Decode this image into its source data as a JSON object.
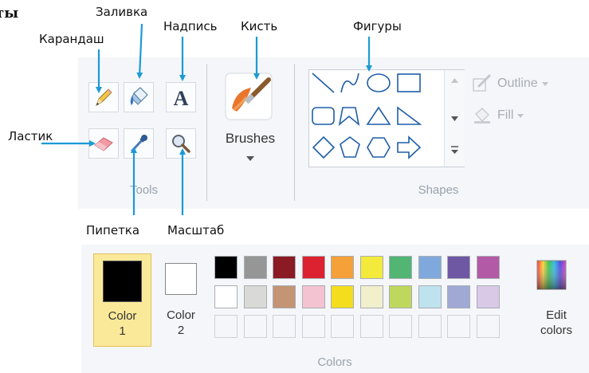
{
  "cutoff_heading": "ты",
  "callouts": {
    "fill": "Заливка",
    "pencil": "Карандаш",
    "text": "Надпись",
    "brush": "Кисть",
    "shapes": "Фигуры",
    "eraser": "Ластик",
    "picker": "Пипетка",
    "magnifier": "Масштаб"
  },
  "ribbon": {
    "tools_label": "Tools",
    "brushes_label": "Brushes",
    "shapes_label": "Shapes",
    "outline_label": "Outline",
    "fill_label": "Fill"
  },
  "colors": {
    "color1_line1": "Color",
    "color1_line2": "1",
    "color2_line1": "Color",
    "color2_line2": "2",
    "edit_line1": "Edit",
    "edit_line2": "colors",
    "group_label": "Colors",
    "color1_value": "#000000",
    "color2_value": "#ffffff",
    "row1": [
      "#000000",
      "#969696",
      "#8a1a24",
      "#dc2230",
      "#f6a03a",
      "#f3ea3c",
      "#52b574",
      "#7fa9dc",
      "#6e58a3",
      "#b35aa6"
    ],
    "row2": [
      "#ffffff",
      "#d9d9d6",
      "#c39574",
      "#f4c3d2",
      "#f4dd1c",
      "#f1efcc",
      "#bed75d",
      "#bfe3ee",
      "#9fa9d4",
      "#d9c9e6"
    ]
  }
}
